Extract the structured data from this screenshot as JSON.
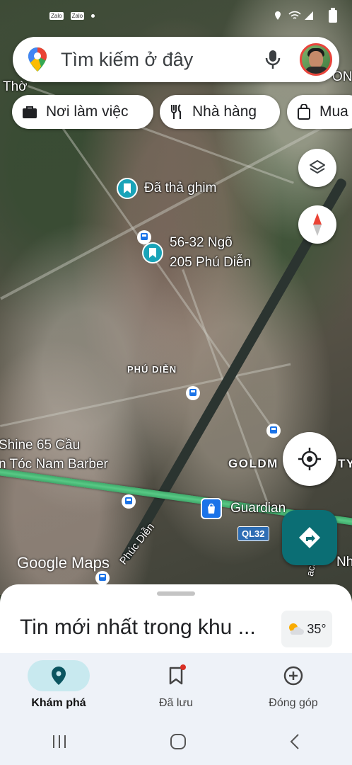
{
  "status_bar": {
    "left_apps": [
      "Zalo",
      "Zalo"
    ]
  },
  "search": {
    "placeholder": "Tìm kiếm ở đây"
  },
  "chips": [
    {
      "label": "Nơi làm việc",
      "icon": "briefcase-icon"
    },
    {
      "label": "Nhà hàng",
      "icon": "fork-knife-icon"
    },
    {
      "label": "Mua",
      "icon": "shopping-bag-icon"
    }
  ],
  "map": {
    "labels": {
      "top_left": "Thờ",
      "top_right": "ON",
      "pinned": "Đã thả ghim",
      "address_line1": "56-32 Ngõ",
      "address_line2": "205 Phú Diễn",
      "district": "PHÚ DIỄN",
      "shine_line1": "Shine 65 Cầu",
      "shine_line2": "n Tóc Nam Barber",
      "goldmark": "GOLDM",
      "goldmark_right": "TY",
      "guardian": "Guardian",
      "street": "Phúc Diễn",
      "ql32": "QL32",
      "right_edge": "Nh",
      "bottom_right": "ach"
    },
    "attribution": "Google Maps"
  },
  "sheet": {
    "title": "Tin mới nhất trong khu ...",
    "temperature": "35°"
  },
  "nav": [
    {
      "label": "Khám phá",
      "icon": "location-pin-icon",
      "active": true
    },
    {
      "label": "Đã lưu",
      "icon": "bookmark-icon",
      "active": false
    },
    {
      "label": "Đóng góp",
      "icon": "add-circle-icon",
      "active": false
    }
  ],
  "colors": {
    "accent": "#0b6e74",
    "pin": "#19a3b8",
    "highway": "#58c985"
  }
}
